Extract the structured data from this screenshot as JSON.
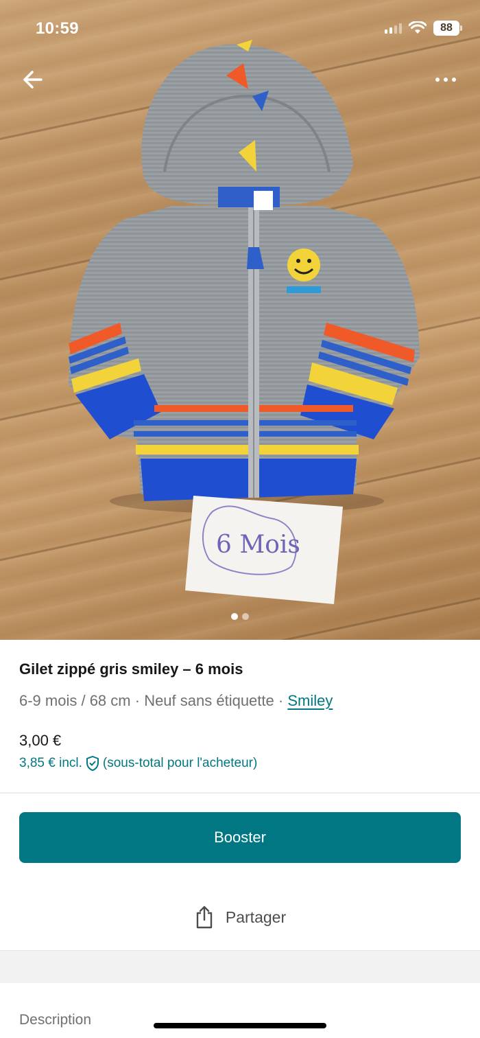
{
  "status_bar": {
    "time": "10:59",
    "battery": "88"
  },
  "nav": {
    "back_icon": "arrow-left-icon",
    "more_icon": "more-horizontal-icon"
  },
  "photo": {
    "note_text": "6 Mois",
    "current_index": 1,
    "total": 2
  },
  "product": {
    "title": "Gilet zippé gris smiley – 6 mois",
    "size": "6-9 mois / 68 cm",
    "separator": "·",
    "condition": "Neuf sans étiquette",
    "brand": "Smiley",
    "price": "3,00 €",
    "price_incl": "3,85 € incl.",
    "price_incl_note": "(sous-total pour l'acheteur)"
  },
  "actions": {
    "booster_label": "Booster",
    "share_label": "Partager"
  },
  "section": {
    "description_label": "Description"
  },
  "colors": {
    "accent": "#007782",
    "text": "#171717",
    "muted": "#707070"
  }
}
